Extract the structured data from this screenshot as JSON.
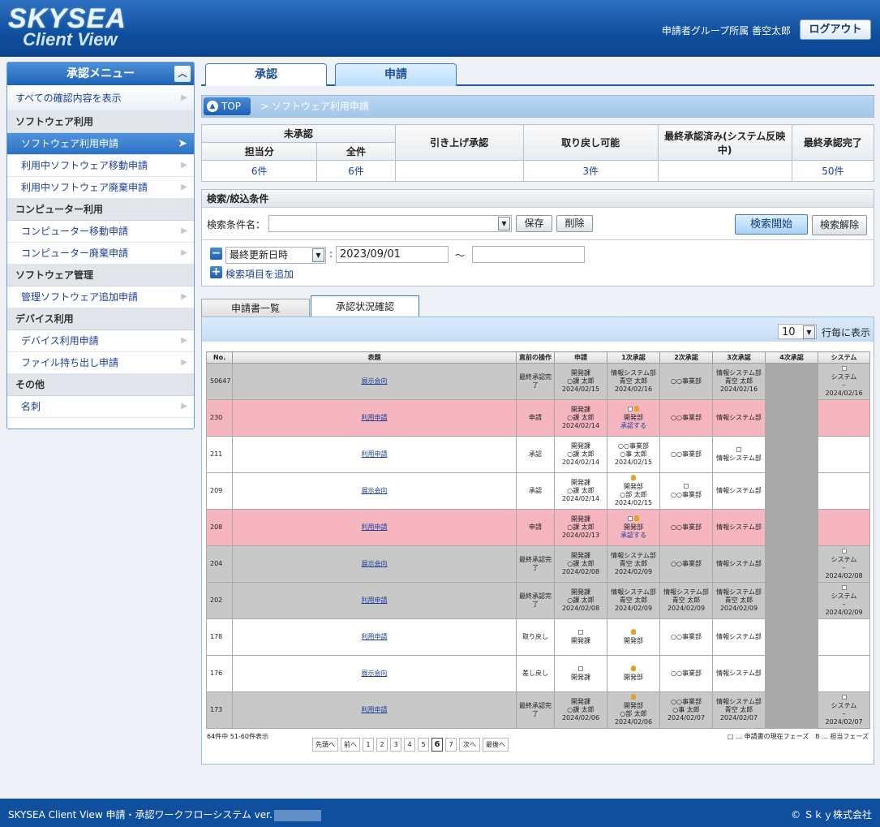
{
  "header": {
    "logo_line1": "SKYSEA",
    "logo_line2": "Client View",
    "user_info": "申請者グループ所属 善空太郎",
    "logout": "ログアウト"
  },
  "sidebar": {
    "title": "承認メニュー",
    "collapse_icon": "chevron-up-icon",
    "show_all": "すべての確認内容を表示",
    "sections": [
      {
        "label": "ソフトウェア利用",
        "items": [
          "ソフトウェア利用申請",
          "利用中ソフトウェア移動申請",
          "利用中ソフトウェア廃棄申請"
        ]
      },
      {
        "label": "コンピューター利用",
        "items": [
          "コンピューター移動申請",
          "コンピューター廃棄申請"
        ]
      },
      {
        "label": "ソフトウェア管理",
        "items": [
          "管理ソフトウェア追加申請"
        ]
      },
      {
        "label": "デバイス利用",
        "items": [
          "デバイス利用申請",
          "ファイル持ち出し申請"
        ]
      },
      {
        "label": "その他",
        "items": [
          "名刺"
        ]
      }
    ]
  },
  "tabs": {
    "approve": "承認",
    "apply": "申請"
  },
  "breadcrumb": {
    "top": "TOP",
    "page": "> ソフトウェア利用申請"
  },
  "status": {
    "unapproved": "未承認",
    "assigned": "担当分",
    "all": "全件",
    "pullup": "引き上げ承認",
    "revertable": "取り戻し可能",
    "final_reflecting": "最終承認済み(システム反映中)",
    "final_done": "最終承認完了",
    "v_assigned": "6件",
    "v_all": "6件",
    "v_revertable": "3件",
    "v_final_done": "50件"
  },
  "search": {
    "title": "検索/絞込条件",
    "cond_label": "検索条件名：",
    "cond_value": "",
    "save": "保存",
    "delete": "削除",
    "start": "検索開始",
    "clear": "検索解除",
    "field": "最終更新日時",
    "colon": ":",
    "date_from": "2023/09/01",
    "tilde": "〜",
    "date_to": "",
    "add_item": "検索項目を追加"
  },
  "subtabs": {
    "list": "申請書一覧",
    "status": "承認状況確認"
  },
  "results": {
    "rows_per_page": "10",
    "rows_label": "行毎に表示",
    "columns": [
      "No.",
      "表題",
      "直前の操作",
      "申請",
      "1次承認",
      "2次承認",
      "3次承認",
      "4次承認",
      "システム"
    ],
    "rows": [
      {
        "no": "50647",
        "title": "展示会向",
        "op": "最終承認完了",
        "apply": [
          "開発課",
          "○課 太郎",
          "2024/02/15"
        ],
        "a1": [
          "情報システム部",
          "青空 太郎",
          "2024/02/16"
        ],
        "a2": [
          "○○事業部"
        ],
        "a3": [
          "情報システム部",
          "青空 太郎",
          "2024/02/16"
        ],
        "sys": [
          "システム",
          "–",
          "2024/02/16"
        ]
      },
      {
        "no": "230",
        "title": "利用申請",
        "op": "申請",
        "apply": [
          "開発課",
          "○課 太郎",
          "2024/02/14"
        ],
        "a1": [
          "開発部",
          "承認する"
        ],
        "a2": [
          "○○事業部"
        ],
        "a3": [
          "情報システム部"
        ],
        "sys": []
      },
      {
        "no": "211",
        "title": "利用申請",
        "op": "承認",
        "apply": [
          "開発課",
          "○課 太郎",
          "2024/02/14"
        ],
        "a1": [
          "○○事業部",
          "○事 太郎",
          "2024/02/15"
        ],
        "a2": [
          "○○事業部"
        ],
        "a3": [
          "情報システム部"
        ],
        "sys": []
      },
      {
        "no": "209",
        "title": "展示会向",
        "op": "承認",
        "apply": [
          "開発課",
          "○課 太郎",
          "2024/02/14"
        ],
        "a1": [
          "開発部",
          "○部 太郎",
          "2024/02/15"
        ],
        "a2": [
          "○○事業部"
        ],
        "a3": [
          "情報システム部"
        ],
        "sys": []
      },
      {
        "no": "208",
        "title": "利用申請",
        "op": "申請",
        "apply": [
          "開発課",
          "○課 太郎",
          "2024/02/13"
        ],
        "a1": [
          "開発部",
          "承認する"
        ],
        "a2": [
          "○○事業部"
        ],
        "a3": [
          "情報システム部"
        ],
        "sys": []
      },
      {
        "no": "204",
        "title": "展示会向",
        "op": "最終承認完了",
        "apply": [
          "開発課",
          "○課 太郎",
          "2024/02/08"
        ],
        "a1": [
          "情報システム部",
          "青空 太郎",
          "2024/02/09"
        ],
        "a2": [
          "○○事業部"
        ],
        "a3": [
          "情報システム部"
        ],
        "sys": [
          "システム",
          "–",
          "2024/02/08"
        ]
      },
      {
        "no": "202",
        "title": "利用申請",
        "op": "最終承認完了",
        "apply": [
          "開発課",
          "○課 太郎",
          "2024/02/08"
        ],
        "a1": [
          "情報システム部",
          "青空 太郎",
          "2024/02/09"
        ],
        "a2": [
          "情報システム部",
          "青空 太郎",
          "2024/02/09"
        ],
        "a3": [
          "情報システム部",
          "青空 太郎",
          "2024/02/09"
        ],
        "sys": [
          "システム",
          "–",
          "2024/02/09"
        ]
      },
      {
        "no": "178",
        "title": "利用申請",
        "op": "取り戻し",
        "apply": [
          "開発課"
        ],
        "a1": [
          "開発部"
        ],
        "a2": [
          "○○事業部"
        ],
        "a3": [
          "情報システム部"
        ],
        "sys": []
      },
      {
        "no": "176",
        "title": "展示会向",
        "op": "差し戻し",
        "apply": [
          "開発課"
        ],
        "a1": [
          "開発部"
        ],
        "a2": [
          "○○事業部"
        ],
        "a3": [
          "情報システム部"
        ],
        "sys": []
      },
      {
        "no": "173",
        "title": "利用申請",
        "op": "最終承認完了",
        "apply": [
          "開発課",
          "○課 太郎",
          "2024/02/06"
        ],
        "a1": [
          "開発部",
          "○部 太郎",
          "2024/02/06"
        ],
        "a2": [
          "○○事業部",
          "○事 太郎",
          "2024/02/07"
        ],
        "a3": [
          "情報システム部",
          "青空 太郎",
          "2024/02/07"
        ],
        "sys": [
          "システム",
          "–",
          "2024/02/07"
        ]
      }
    ],
    "pager_info": "64件中 51-60件表示",
    "legend": "□ … 申請書の現在フェーズ　8 … 担当フェーズ",
    "pager": [
      "先頭へ",
      "前へ",
      "1",
      "2",
      "3",
      "4",
      "5",
      "6",
      "7",
      "次へ",
      "最後へ"
    ],
    "current_page": "6"
  },
  "footer": {
    "left": "SKYSEA Client View 申請・承認ワークフローシステム ver.",
    "right": "© Ｓｋｙ株式会社"
  }
}
